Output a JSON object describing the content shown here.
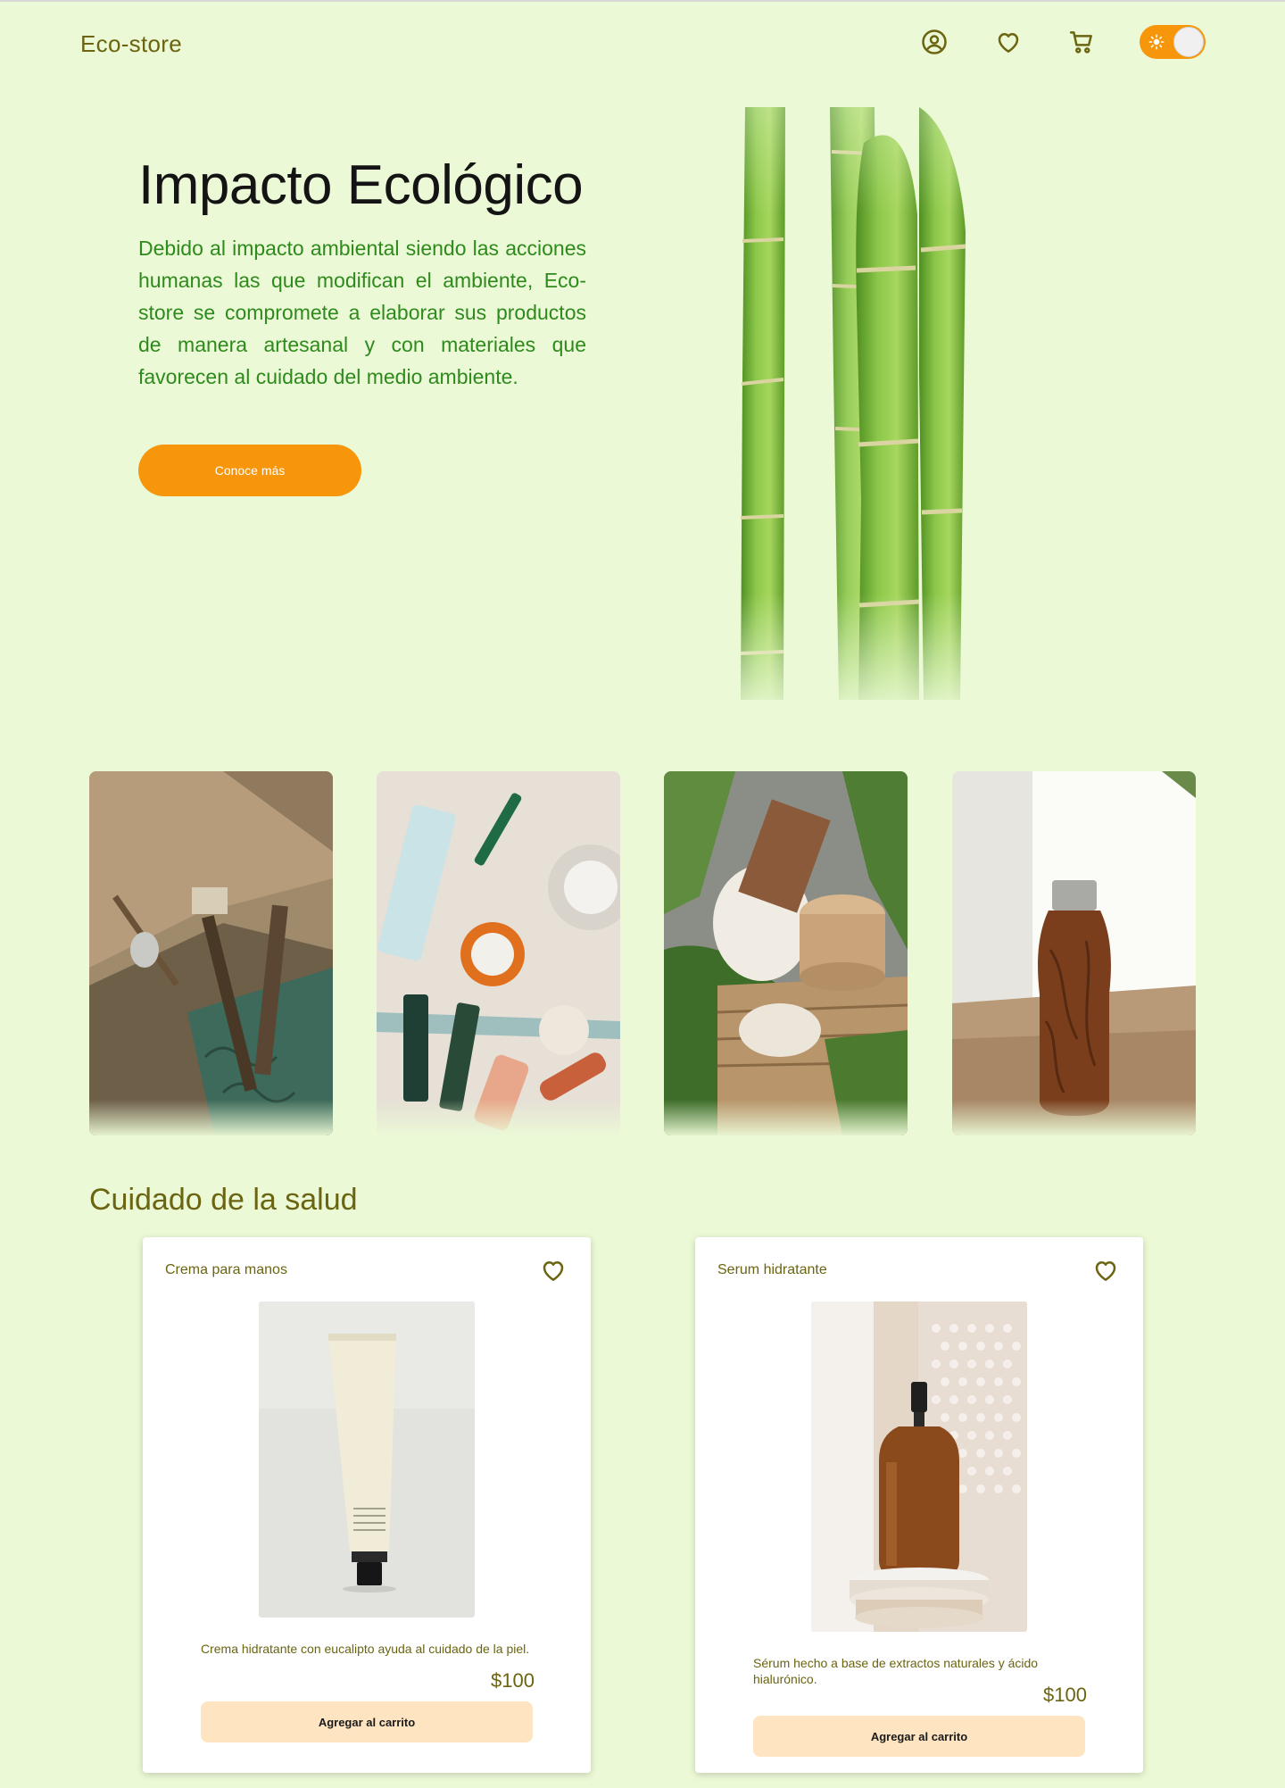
{
  "header": {
    "brand": "Eco-store",
    "icons": [
      "user-circle-icon",
      "heart-icon",
      "cart-icon"
    ],
    "theme_toggle": {
      "state": "light",
      "icon": "sun-icon"
    }
  },
  "hero": {
    "title": "Impacto Ecológico",
    "text": "Debido al impacto ambiental siendo las acciones humanas las que modifican el ambiente, Eco-store se compromete a elaborar sus productos de manera artesanal y con materiales que favorecen al cuidado del medio ambiente.",
    "cta_label": "Conoce más",
    "image": "bamboo-stalks"
  },
  "gallery": [
    {
      "image": "packaged-bamboo-toothbrushes"
    },
    {
      "image": "skincare-products-flatlay"
    },
    {
      "image": "eco-gift-set-with-plants"
    },
    {
      "image": "wood-pattern-water-bottle"
    }
  ],
  "section": {
    "title": "Cuidado de la salud",
    "products": [
      {
        "name": "Crema para manos",
        "description": "Crema hidratante con eucalipto ayuda al cuidado de la piel.",
        "price": "$100",
        "button_label": "Agregar al carrito",
        "image": "hand-cream-tube"
      },
      {
        "name": "Serum hidratante",
        "description": "Sérum hecho a base de extractos naturales y ácido hialurónico.",
        "price": "$100",
        "button_label": "Agregar al carrito",
        "image": "serum-dropper-bottle"
      }
    ]
  },
  "colors": {
    "background": "#ebf9d6",
    "brand_text": "#6b6410",
    "accent_orange": "#f7960a",
    "hero_text_green": "#2e8a1c",
    "cart_button": "#ffe4c2"
  }
}
